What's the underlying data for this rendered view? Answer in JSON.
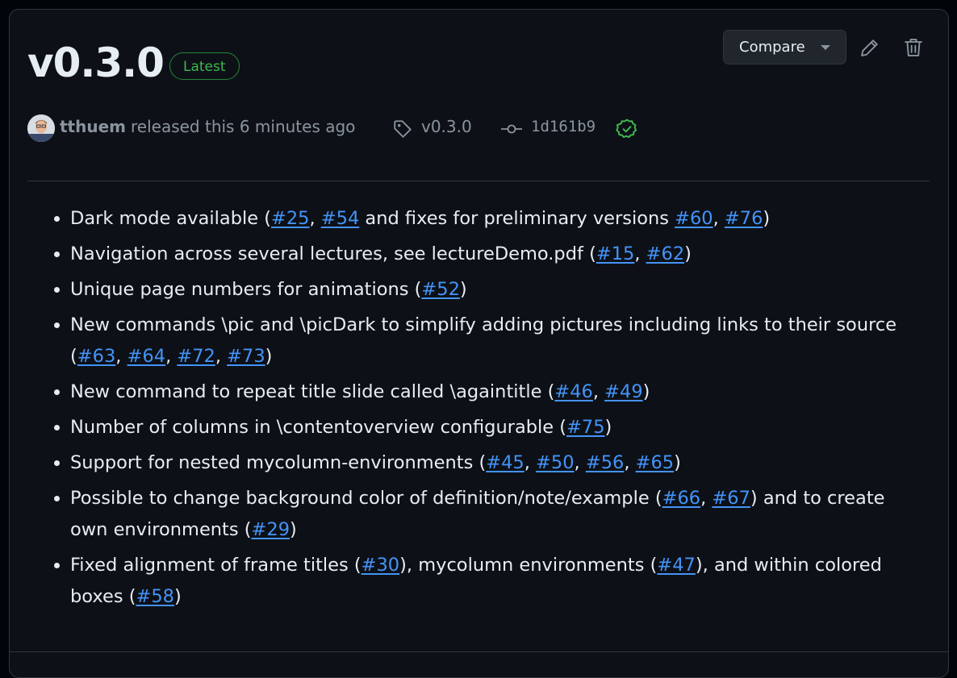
{
  "release": {
    "title": "v0.3.0",
    "badge": "Latest",
    "compare_label": "Compare",
    "author": "tthuem",
    "released_text": "released this 6 minutes ago",
    "tag": "v0.3.0",
    "commit": "1d161b9"
  },
  "icons": {
    "edit": "pencil-icon",
    "delete": "trash-icon",
    "tag": "tag-icon",
    "commit": "git-commit-icon",
    "verified": "verified-check-icon"
  },
  "colors": {
    "background": "#0d1117",
    "text": "#e6edf3",
    "muted": "#8b949e",
    "link": "#4493f8",
    "badge": "#3fb950",
    "border": "#30363d"
  },
  "notes": [
    {
      "id": "dark-mode",
      "parts": [
        {
          "t": "Dark mode available ("
        },
        {
          "link": "#25"
        },
        {
          "t": ", "
        },
        {
          "link": "#54"
        },
        {
          "t": " and fixes for preliminary versions "
        },
        {
          "link": "#60"
        },
        {
          "t": ", "
        },
        {
          "link": "#76"
        },
        {
          "t": ")"
        }
      ]
    },
    {
      "id": "navigation",
      "parts": [
        {
          "t": "Navigation across several lectures, see lectureDemo.pdf ("
        },
        {
          "link": "#15"
        },
        {
          "t": ", "
        },
        {
          "link": "#62"
        },
        {
          "t": ")"
        }
      ]
    },
    {
      "id": "page-numbers",
      "parts": [
        {
          "t": "Unique page numbers for animations ("
        },
        {
          "link": "#52"
        },
        {
          "t": ")"
        }
      ]
    },
    {
      "id": "pic-commands",
      "parts": [
        {
          "t": "New commands \\pic and \\picDark to simplify adding pictures including links to their source ("
        },
        {
          "link": "#63"
        },
        {
          "t": ", "
        },
        {
          "link": "#64"
        },
        {
          "t": ", "
        },
        {
          "link": "#72"
        },
        {
          "t": ", "
        },
        {
          "link": "#73"
        },
        {
          "t": ")"
        }
      ]
    },
    {
      "id": "againtitle",
      "parts": [
        {
          "t": "New command to repeat title slide called \\againtitle ("
        },
        {
          "link": "#46"
        },
        {
          "t": ", "
        },
        {
          "link": "#49"
        },
        {
          "t": ")"
        }
      ]
    },
    {
      "id": "contentoverview",
      "parts": [
        {
          "t": "Number of columns in \\contentoverview configurable ("
        },
        {
          "link": "#75"
        },
        {
          "t": ")"
        }
      ]
    },
    {
      "id": "nested-mycolumn",
      "parts": [
        {
          "t": "Support for nested mycolumn-environments ("
        },
        {
          "link": "#45"
        },
        {
          "t": ", "
        },
        {
          "link": "#50"
        },
        {
          "t": ", "
        },
        {
          "link": "#56"
        },
        {
          "t": ", "
        },
        {
          "link": "#65"
        },
        {
          "t": ")"
        }
      ]
    },
    {
      "id": "background-color",
      "parts": [
        {
          "t": "Possible to change background color of definition/note/example ("
        },
        {
          "link": "#66"
        },
        {
          "t": ", "
        },
        {
          "link": "#67"
        },
        {
          "t": ") and to create own environments ("
        },
        {
          "link": "#29"
        },
        {
          "t": ")"
        }
      ]
    },
    {
      "id": "alignment",
      "parts": [
        {
          "t": "Fixed alignment of frame titles ("
        },
        {
          "link": "#30"
        },
        {
          "t": "), mycolumn environments ("
        },
        {
          "link": "#47"
        },
        {
          "t": "), and within colored boxes ("
        },
        {
          "link": "#58"
        },
        {
          "t": ")"
        }
      ]
    }
  ]
}
